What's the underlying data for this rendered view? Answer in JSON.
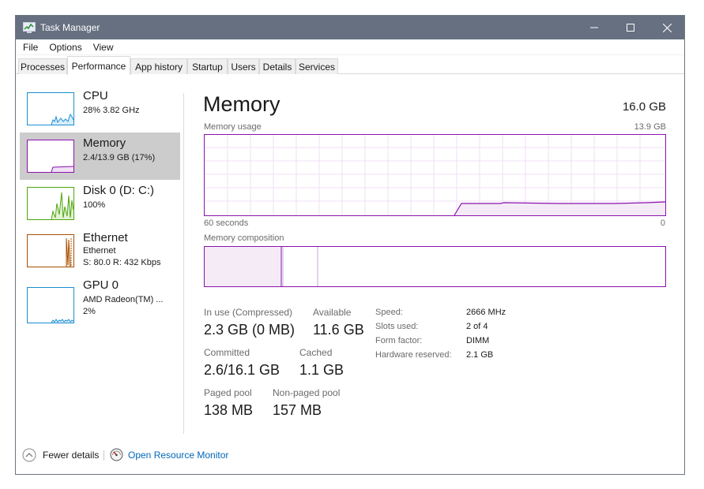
{
  "window": {
    "title": "Task Manager"
  },
  "menu": [
    "File",
    "Options",
    "View"
  ],
  "tabs": [
    "Processes",
    "Performance",
    "App history",
    "Startup",
    "Users",
    "Details",
    "Services"
  ],
  "sidebar": {
    "items": [
      {
        "name": "CPU",
        "sub1": "28%  3.82 GHz",
        "sub2": ""
      },
      {
        "name": "Memory",
        "sub1": "2.4/13.9 GB (17%)",
        "sub2": ""
      },
      {
        "name": "Disk 0 (D: C:)",
        "sub1": "100%",
        "sub2": ""
      },
      {
        "name": "Ethernet",
        "sub1": "Ethernet",
        "sub2": "S: 80.0  R: 432 Kbps"
      },
      {
        "name": "GPU 0",
        "sub1": "AMD Radeon(TM) ...",
        "sub2": "2%"
      }
    ]
  },
  "main": {
    "title": "Memory",
    "total": "16.0 GB",
    "usage_label": "Memory usage",
    "usage_max": "13.9 GB",
    "axis_left": "60 seconds",
    "axis_right": "0",
    "composition_label": "Memory composition",
    "usage_fraction": 0.17
  },
  "stats": {
    "in_use_label": "In use (Compressed)",
    "in_use_value": "2.3 GB (0 MB)",
    "available_label": "Available",
    "available_value": "11.6 GB",
    "committed_label": "Committed",
    "committed_value": "2.6/16.1 GB",
    "cached_label": "Cached",
    "cached_value": "1.1 GB",
    "paged_label": "Paged pool",
    "paged_value": "138 MB",
    "nonpaged_label": "Non-paged pool",
    "nonpaged_value": "157 MB"
  },
  "specs": [
    {
      "label": "Speed:",
      "value": "2666 MHz"
    },
    {
      "label": "Slots used:",
      "value": "2 of 4"
    },
    {
      "label": "Form factor:",
      "value": "DIMM"
    },
    {
      "label": "Hardware reserved:",
      "value": "2.1 GB"
    }
  ],
  "footer": {
    "fewer_details": "Fewer details",
    "open_monitor": "Open Resource Monitor"
  },
  "colors": {
    "cpu": "#1c8fd1",
    "memory": "#8b12ae",
    "disk": "#4da60c",
    "ethernet": "#a74f01",
    "gpu": "#1c8fd1",
    "titlebar": "#667080",
    "link": "#0067b8"
  },
  "icons": {
    "app": "task-manager-icon",
    "minimize": "minimize-icon",
    "maximize": "maximize-icon",
    "close": "close-icon",
    "fewer": "chevron-up-circle-icon",
    "monitor": "resource-monitor-icon"
  }
}
